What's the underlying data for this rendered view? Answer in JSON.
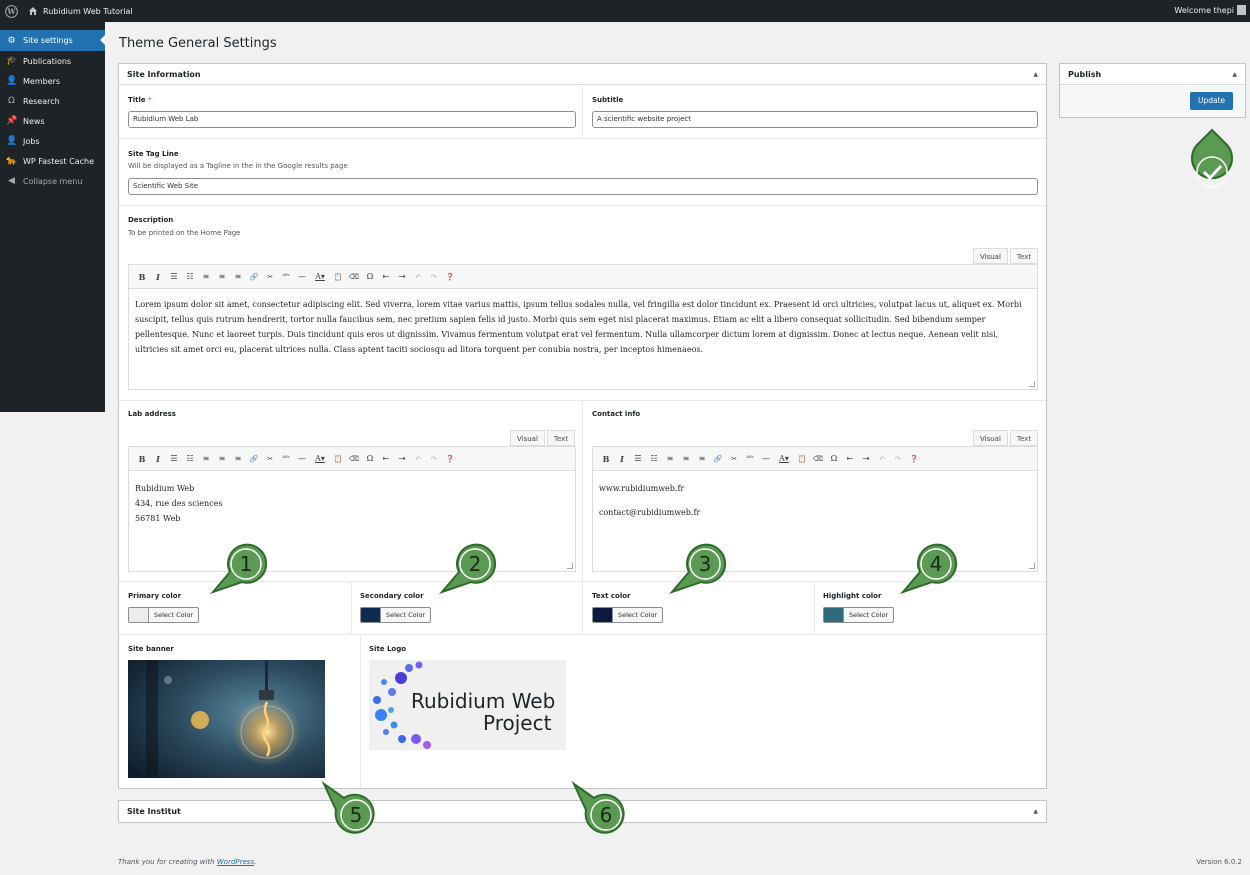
{
  "adminbar": {
    "site_name": "Rubidium Web Tutorial",
    "welcome": "Welcome thepi"
  },
  "sidebar": {
    "items": [
      {
        "label": "Site settings",
        "icon": "gear-icon"
      },
      {
        "label": "Publications",
        "icon": "graduation-cap-icon"
      },
      {
        "label": "Members",
        "icon": "person-icon"
      },
      {
        "label": "Research",
        "icon": "omega-icon"
      },
      {
        "label": "News",
        "icon": "pin-icon"
      },
      {
        "label": "Jobs",
        "icon": "person-icon"
      },
      {
        "label": "WP Fastest Cache",
        "icon": "cheetah-icon"
      },
      {
        "label": "Collapse menu",
        "icon": "collapse-icon"
      }
    ]
  },
  "page": {
    "title": "Theme General Settings"
  },
  "site_info": {
    "panel_title": "Site Information",
    "title_label": "Title",
    "title_required": "*",
    "title_value": "Rubidium Web Lab",
    "subtitle_label": "Subtitle",
    "subtitle_value": "A scientific website project",
    "tagline_label": "Site Tag Line",
    "tagline_hint": "Will be displayed as a Tagline in the in the Google results page",
    "tagline_value": "Scientific Web Site",
    "description_label": "Description",
    "description_hint": "To be printed on the Home Page",
    "description_text": "Lorem ipsum dolor sit amet, consectetur adipiscing elit. Sed viverra, lorem vitae varius mattis, ipsum tellus sodales nulla, vel fringilla est dolor tincidunt ex. Praesent id orci ultricies, volutpat lacus ut, aliquet ex. Morbi suscipit, tellus quis rutrum hendrerit, tortor nulla faucibus sem, nec pretium sapien felis id justo. Morbi quis sem eget nisi placerat maximus. Etiam ac elit a libero consequat sollicitudin. Sed bibendum semper pellentesque. Nunc et laoreet turpis. Duis tincidunt quis eros ut dignissim. Vivamus fermentum volutpat erat vel fermentum. Nulla ullamcorper dictum lorem at dignissim. Donec at lectus neque. Aenean velit nisi, ultricies sit amet orci eu, placerat ultrices nulla. Class aptent taciti sociosqu ad litora torquent per conubia nostra, per inceptos himenaeos.",
    "lab_address_label": "Lab address",
    "lab_address_lines": [
      "Rubidium Web",
      "434, rue des sciences",
      "56781 Web"
    ],
    "contact_label": "Contact info",
    "contact_lines": [
      "www.rubidiumweb.fr",
      "contact@rubidiumweb.fr"
    ],
    "tab_visual": "Visual",
    "tab_text": "Text",
    "colors": [
      {
        "label": "Primary color",
        "value": "#ececec"
      },
      {
        "label": "Secondary color",
        "value": "#0e2a4f"
      },
      {
        "label": "Text color",
        "value": "#0c1b3d"
      },
      {
        "label": "Highlight color",
        "value": "#2f6b7b"
      }
    ],
    "select_color_label": "Select Color",
    "banner_label": "Site banner",
    "logo_label": "Site Logo",
    "logo_text_line1": "Rubidium Web",
    "logo_text_line2": "Project"
  },
  "publish": {
    "panel_title": "Publish",
    "update_label": "Update"
  },
  "site_institut": {
    "panel_title": "Site Institut"
  },
  "markers": [
    "1",
    "2",
    "3",
    "4",
    "5",
    "6"
  ],
  "footer": {
    "thanks_prefix": "Thank you for creating with ",
    "thanks_link": "WordPress",
    "thanks_suffix": ".",
    "version": "Version 6.0.2"
  },
  "accent_colors": {
    "admin_blue": "#2271b1",
    "marker_green": "#5a9a52",
    "marker_dark": "#2f6b2b"
  }
}
